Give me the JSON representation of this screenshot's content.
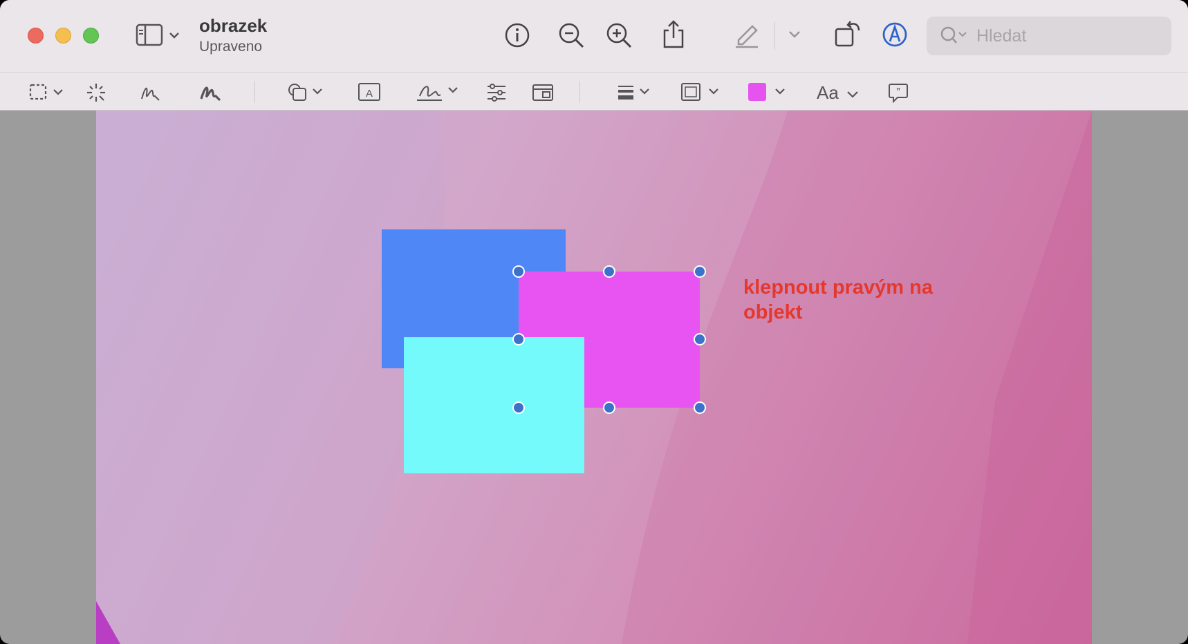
{
  "window": {
    "title": "obrazek",
    "subtitle": "Upraveno",
    "traffic_lights": {
      "close": "#ed6a5e",
      "minimize": "#f5bf4f",
      "maximize": "#62c554"
    }
  },
  "toolbar": {
    "icons": [
      "sidebar-icon",
      "info-icon",
      "zoom-out-icon",
      "zoom-in-icon",
      "share-icon",
      "highlight-pen-icon",
      "rotate-icon",
      "markup-icon"
    ]
  },
  "search": {
    "placeholder": "Hledat"
  },
  "markup_toolbar": {
    "icons": [
      "selection-tool-icon",
      "instant-alpha-icon",
      "sketch-icon",
      "draw-icon",
      "shapes-icon",
      "text-icon",
      "sign-icon",
      "adjust-color-icon",
      "adjust-size-icon",
      "shape-style-icon",
      "border-color-icon",
      "fill-color-icon",
      "text-style-icon",
      "description-icon"
    ],
    "text_style_label": "Aa",
    "fill_color": "#e654f0"
  },
  "canvas": {
    "shapes": [
      {
        "name": "blue-rectangle",
        "color": "#4f87f7"
      },
      {
        "name": "magenta-rectangle",
        "color": "#e854f2",
        "selected": true
      },
      {
        "name": "cyan-rectangle",
        "color": "#75fafb"
      }
    ],
    "annotation": "klepnout pravým na objekt"
  }
}
